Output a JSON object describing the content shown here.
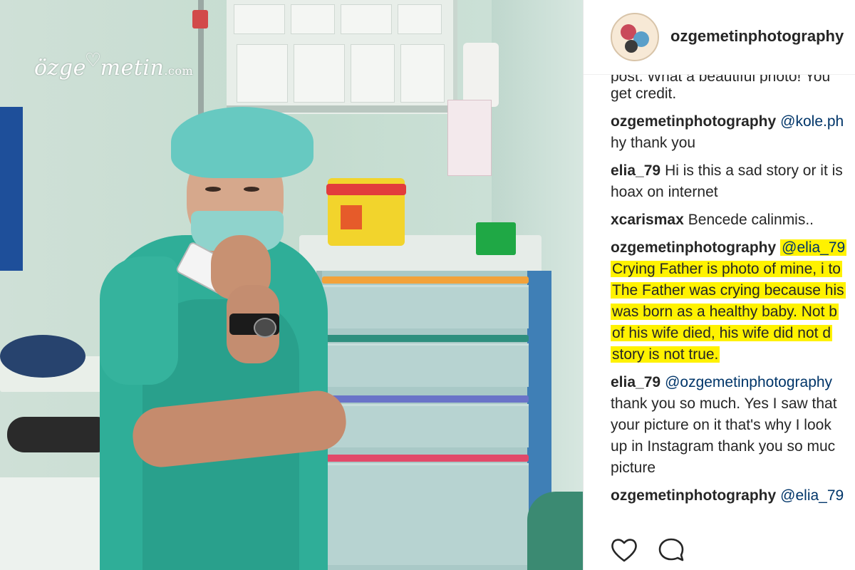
{
  "photo": {
    "watermark": {
      "name_part1": "özge",
      "name_part2": "metin",
      "domain": ".com",
      "heart_glyph": "♡"
    }
  },
  "post": {
    "header": {
      "username": "ozgemetinphotography"
    },
    "comments": [
      {
        "user": "",
        "lines": [
          "post. What a beautiful photo! You",
          "get credit."
        ]
      },
      {
        "user": "ozgemetinphotography",
        "mention": "@kole.ph",
        "lines": [
          "hy thank you"
        ]
      },
      {
        "user": "elia_79",
        "first_line": "Hi is this a sad story or it is",
        "lines": [
          "hoax on internet"
        ]
      },
      {
        "user": "xcarismax",
        "first_line": "Bencede calinmis.."
      },
      {
        "user": "ozgemetinphotography",
        "mention": "@elia_79",
        "highlighted_lines": [
          "Crying Father is photo of mine, i to",
          "The Father was crying because his",
          "was born as a healthy baby. Not b",
          "of his wife died, his wife did not d",
          "story is not true."
        ]
      },
      {
        "user": "elia_79",
        "mention": "@ozgemetinphotography",
        "lines": [
          "thank you so much. Yes I saw that",
          "your picture on it that's why I look",
          "up in Instagram thank you so muc",
          "picture"
        ]
      },
      {
        "user": "ozgemetinphotography",
        "mention": "@elia_79"
      }
    ],
    "actions": {
      "like_icon": "heart-outline",
      "comment_icon": "speech-bubble-outline"
    }
  },
  "colors": {
    "highlight": "#fff200",
    "mention": "#003569",
    "text": "#262626",
    "scrubs": "#2fae98"
  }
}
